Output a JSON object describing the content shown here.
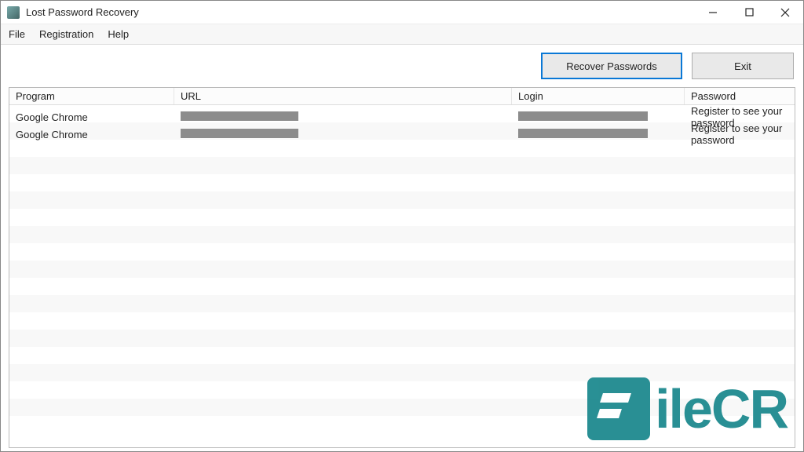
{
  "window": {
    "title": "Lost Password Recovery"
  },
  "menu": {
    "file": "File",
    "registration": "Registration",
    "help": "Help"
  },
  "toolbar": {
    "recover": "Recover Passwords",
    "exit": "Exit"
  },
  "grid": {
    "headers": {
      "program": "Program",
      "url": "URL",
      "login": "Login",
      "password": "Password"
    },
    "rows": [
      {
        "program": "Google Chrome",
        "url_redacted": true,
        "login_redacted": true,
        "password": "Register to see your password"
      },
      {
        "program": "Google Chrome",
        "url_redacted": true,
        "login_redacted": true,
        "password": "Register to see your password"
      }
    ]
  },
  "watermark": {
    "text": "ileCR"
  }
}
